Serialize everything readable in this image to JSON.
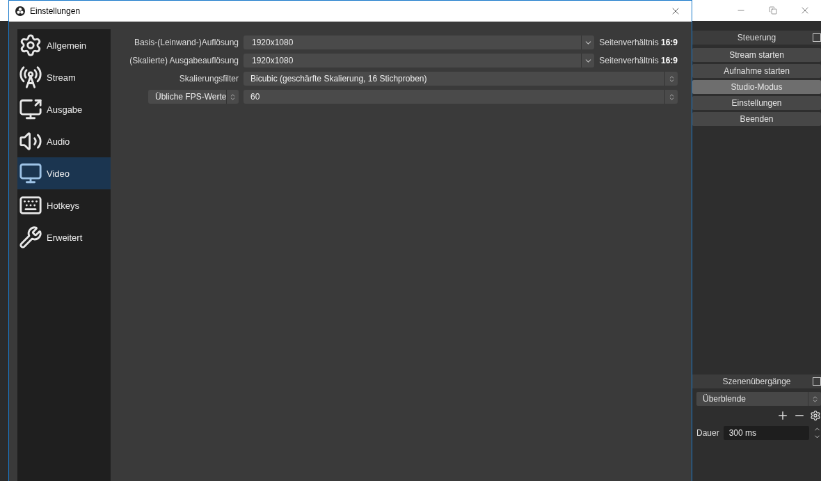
{
  "background_window": {
    "controls_dock": {
      "title": "Steuerung",
      "buttons": [
        {
          "label": "Stream starten",
          "selected": false
        },
        {
          "label": "Aufnahme starten",
          "selected": false
        },
        {
          "label": "Studio-Modus",
          "selected": true
        },
        {
          "label": "Einstellungen",
          "selected": false
        },
        {
          "label": "Beenden",
          "selected": false
        }
      ]
    },
    "transitions_dock": {
      "title": "Szenenübergänge",
      "transition": "Überblende",
      "duration_label": "Dauer",
      "duration": "300 ms"
    }
  },
  "dialog": {
    "title": "Einstellungen",
    "sidebar": {
      "items": [
        {
          "label": "Allgemein",
          "selected": false
        },
        {
          "label": "Stream",
          "selected": false
        },
        {
          "label": "Ausgabe",
          "selected": false
        },
        {
          "label": "Audio",
          "selected": false
        },
        {
          "label": "Video",
          "selected": true
        },
        {
          "label": "Hotkeys",
          "selected": false
        },
        {
          "label": "Erweitert",
          "selected": false
        }
      ]
    },
    "video": {
      "rows": [
        {
          "kind": "dropdown",
          "label": "Basis-(Leinwand-)Auflösung",
          "value": "1920x1080",
          "aspect": "Seitenverhältnis **16:9**"
        },
        {
          "kind": "dropdown",
          "label": "(Skalierte) Ausgabeauflösung",
          "value": "1920x1080",
          "aspect": "Seitenverhältnis **16:9**"
        },
        {
          "kind": "spinner",
          "label": "Skalierungsfilter",
          "value": "Bicubic (geschärfte Skalierung, 16 Stichproben)"
        },
        {
          "kind": "fps",
          "selector": "Übliche FPS-Werte",
          "value": "60"
        }
      ]
    }
  }
}
